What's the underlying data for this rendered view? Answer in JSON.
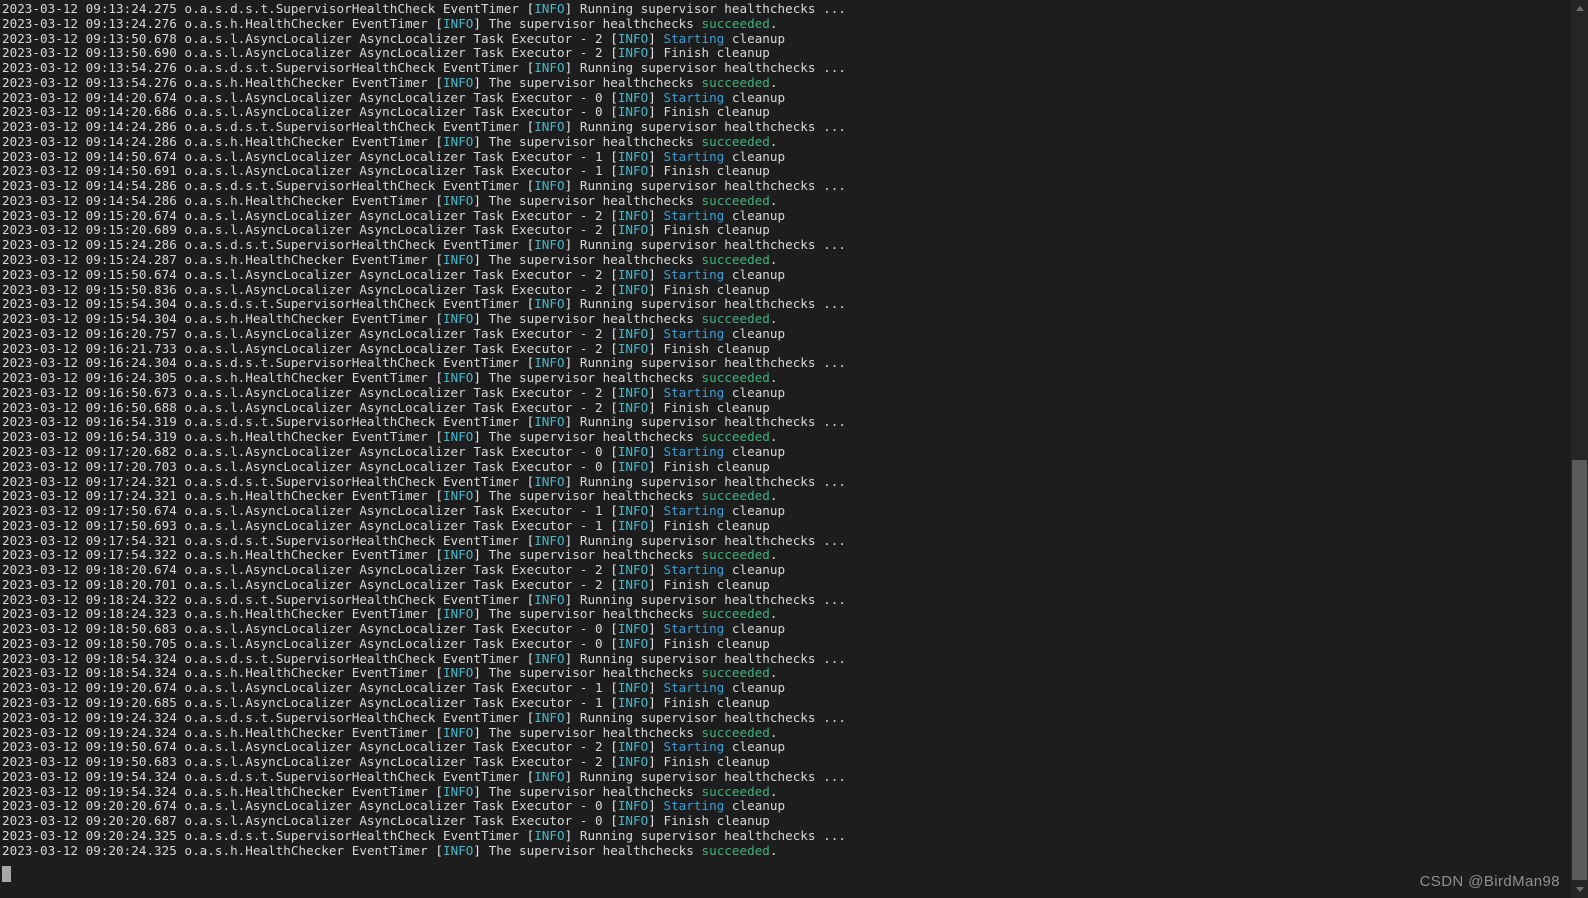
{
  "terminal": {
    "background_color": "#1d1d1d",
    "default_text_color": "#d8d8d8",
    "level_color": "#49b8c9",
    "success_color": "#3fb27f",
    "starting_color": "#3a9fd8",
    "cursor": {
      "name": "block-cursor",
      "color": "#a8a8a8"
    }
  },
  "scrollbar": {
    "up_arrow": "▲",
    "down_arrow": "▼",
    "thumb_color": "#5a5a5a",
    "track_color": "#252525"
  },
  "watermark": {
    "text": "CSDN @BirdMan98"
  },
  "log": {
    "lines": [
      {
        "ts": "2023-03-12 09:13:24.275",
        "logger": "o.a.s.d.s.t.SupervisorHealthCheck",
        "thread": "EventTimer",
        "level": "INFO",
        "msg_pre": "Running supervisor healthchecks ...",
        "hl": "",
        "msg_post": ""
      },
      {
        "ts": "2023-03-12 09:13:24.276",
        "logger": "o.a.s.h.HealthChecker",
        "thread": "EventTimer",
        "level": "INFO",
        "msg_pre": "The supervisor healthchecks ",
        "hl": "succeeded",
        "hl_kind": "ok",
        "msg_post": "."
      },
      {
        "ts": "2023-03-12 09:13:50.678",
        "logger": "o.a.s.l.AsyncLocalizer",
        "thread": "AsyncLocalizer Task Executor - 2",
        "level": "INFO",
        "msg_pre": "",
        "hl": "Starting",
        "hl_kind": "start",
        "msg_post": " cleanup"
      },
      {
        "ts": "2023-03-12 09:13:50.690",
        "logger": "o.a.s.l.AsyncLocalizer",
        "thread": "AsyncLocalizer Task Executor - 2",
        "level": "INFO",
        "msg_pre": "Finish cleanup",
        "hl": "",
        "msg_post": ""
      },
      {
        "ts": "2023-03-12 09:13:54.276",
        "logger": "o.a.s.d.s.t.SupervisorHealthCheck",
        "thread": "EventTimer",
        "level": "INFO",
        "msg_pre": "Running supervisor healthchecks ...",
        "hl": "",
        "msg_post": ""
      },
      {
        "ts": "2023-03-12 09:13:54.276",
        "logger": "o.a.s.h.HealthChecker",
        "thread": "EventTimer",
        "level": "INFO",
        "msg_pre": "The supervisor healthchecks ",
        "hl": "succeeded",
        "hl_kind": "ok",
        "msg_post": "."
      },
      {
        "ts": "2023-03-12 09:14:20.674",
        "logger": "o.a.s.l.AsyncLocalizer",
        "thread": "AsyncLocalizer Task Executor - 0",
        "level": "INFO",
        "msg_pre": "",
        "hl": "Starting",
        "hl_kind": "start",
        "msg_post": " cleanup"
      },
      {
        "ts": "2023-03-12 09:14:20.686",
        "logger": "o.a.s.l.AsyncLocalizer",
        "thread": "AsyncLocalizer Task Executor - 0",
        "level": "INFO",
        "msg_pre": "Finish cleanup",
        "hl": "",
        "msg_post": ""
      },
      {
        "ts": "2023-03-12 09:14:24.286",
        "logger": "o.a.s.d.s.t.SupervisorHealthCheck",
        "thread": "EventTimer",
        "level": "INFO",
        "msg_pre": "Running supervisor healthchecks ...",
        "hl": "",
        "msg_post": ""
      },
      {
        "ts": "2023-03-12 09:14:24.286",
        "logger": "o.a.s.h.HealthChecker",
        "thread": "EventTimer",
        "level": "INFO",
        "msg_pre": "The supervisor healthchecks ",
        "hl": "succeeded",
        "hl_kind": "ok",
        "msg_post": "."
      },
      {
        "ts": "2023-03-12 09:14:50.674",
        "logger": "o.a.s.l.AsyncLocalizer",
        "thread": "AsyncLocalizer Task Executor - 1",
        "level": "INFO",
        "msg_pre": "",
        "hl": "Starting",
        "hl_kind": "start",
        "msg_post": " cleanup"
      },
      {
        "ts": "2023-03-12 09:14:50.691",
        "logger": "o.a.s.l.AsyncLocalizer",
        "thread": "AsyncLocalizer Task Executor - 1",
        "level": "INFO",
        "msg_pre": "Finish cleanup",
        "hl": "",
        "msg_post": ""
      },
      {
        "ts": "2023-03-12 09:14:54.286",
        "logger": "o.a.s.d.s.t.SupervisorHealthCheck",
        "thread": "EventTimer",
        "level": "INFO",
        "msg_pre": "Running supervisor healthchecks ...",
        "hl": "",
        "msg_post": ""
      },
      {
        "ts": "2023-03-12 09:14:54.286",
        "logger": "o.a.s.h.HealthChecker",
        "thread": "EventTimer",
        "level": "INFO",
        "msg_pre": "The supervisor healthchecks ",
        "hl": "succeeded",
        "hl_kind": "ok",
        "msg_post": "."
      },
      {
        "ts": "2023-03-12 09:15:20.674",
        "logger": "o.a.s.l.AsyncLocalizer",
        "thread": "AsyncLocalizer Task Executor - 2",
        "level": "INFO",
        "msg_pre": "",
        "hl": "Starting",
        "hl_kind": "start",
        "msg_post": " cleanup"
      },
      {
        "ts": "2023-03-12 09:15:20.689",
        "logger": "o.a.s.l.AsyncLocalizer",
        "thread": "AsyncLocalizer Task Executor - 2",
        "level": "INFO",
        "msg_pre": "Finish cleanup",
        "hl": "",
        "msg_post": ""
      },
      {
        "ts": "2023-03-12 09:15:24.286",
        "logger": "o.a.s.d.s.t.SupervisorHealthCheck",
        "thread": "EventTimer",
        "level": "INFO",
        "msg_pre": "Running supervisor healthchecks ...",
        "hl": "",
        "msg_post": ""
      },
      {
        "ts": "2023-03-12 09:15:24.287",
        "logger": "o.a.s.h.HealthChecker",
        "thread": "EventTimer",
        "level": "INFO",
        "msg_pre": "The supervisor healthchecks ",
        "hl": "succeeded",
        "hl_kind": "ok",
        "msg_post": "."
      },
      {
        "ts": "2023-03-12 09:15:50.674",
        "logger": "o.a.s.l.AsyncLocalizer",
        "thread": "AsyncLocalizer Task Executor - 2",
        "level": "INFO",
        "msg_pre": "",
        "hl": "Starting",
        "hl_kind": "start",
        "msg_post": " cleanup"
      },
      {
        "ts": "2023-03-12 09:15:50.836",
        "logger": "o.a.s.l.AsyncLocalizer",
        "thread": "AsyncLocalizer Task Executor - 2",
        "level": "INFO",
        "msg_pre": "Finish cleanup",
        "hl": "",
        "msg_post": ""
      },
      {
        "ts": "2023-03-12 09:15:54.304",
        "logger": "o.a.s.d.s.t.SupervisorHealthCheck",
        "thread": "EventTimer",
        "level": "INFO",
        "msg_pre": "Running supervisor healthchecks ...",
        "hl": "",
        "msg_post": ""
      },
      {
        "ts": "2023-03-12 09:15:54.304",
        "logger": "o.a.s.h.HealthChecker",
        "thread": "EventTimer",
        "level": "INFO",
        "msg_pre": "The supervisor healthchecks ",
        "hl": "succeeded",
        "hl_kind": "ok",
        "msg_post": "."
      },
      {
        "ts": "2023-03-12 09:16:20.757",
        "logger": "o.a.s.l.AsyncLocalizer",
        "thread": "AsyncLocalizer Task Executor - 2",
        "level": "INFO",
        "msg_pre": "",
        "hl": "Starting",
        "hl_kind": "start",
        "msg_post": " cleanup"
      },
      {
        "ts": "2023-03-12 09:16:21.733",
        "logger": "o.a.s.l.AsyncLocalizer",
        "thread": "AsyncLocalizer Task Executor - 2",
        "level": "INFO",
        "msg_pre": "Finish cleanup",
        "hl": "",
        "msg_post": ""
      },
      {
        "ts": "2023-03-12 09:16:24.304",
        "logger": "o.a.s.d.s.t.SupervisorHealthCheck",
        "thread": "EventTimer",
        "level": "INFO",
        "msg_pre": "Running supervisor healthchecks ...",
        "hl": "",
        "msg_post": ""
      },
      {
        "ts": "2023-03-12 09:16:24.305",
        "logger": "o.a.s.h.HealthChecker",
        "thread": "EventTimer",
        "level": "INFO",
        "msg_pre": "The supervisor healthchecks ",
        "hl": "succeeded",
        "hl_kind": "ok",
        "msg_post": "."
      },
      {
        "ts": "2023-03-12 09:16:50.673",
        "logger": "o.a.s.l.AsyncLocalizer",
        "thread": "AsyncLocalizer Task Executor - 2",
        "level": "INFO",
        "msg_pre": "",
        "hl": "Starting",
        "hl_kind": "start",
        "msg_post": " cleanup"
      },
      {
        "ts": "2023-03-12 09:16:50.688",
        "logger": "o.a.s.l.AsyncLocalizer",
        "thread": "AsyncLocalizer Task Executor - 2",
        "level": "INFO",
        "msg_pre": "Finish cleanup",
        "hl": "",
        "msg_post": ""
      },
      {
        "ts": "2023-03-12 09:16:54.319",
        "logger": "o.a.s.d.s.t.SupervisorHealthCheck",
        "thread": "EventTimer",
        "level": "INFO",
        "msg_pre": "Running supervisor healthchecks ...",
        "hl": "",
        "msg_post": ""
      },
      {
        "ts": "2023-03-12 09:16:54.319",
        "logger": "o.a.s.h.HealthChecker",
        "thread": "EventTimer",
        "level": "INFO",
        "msg_pre": "The supervisor healthchecks ",
        "hl": "succeeded",
        "hl_kind": "ok",
        "msg_post": "."
      },
      {
        "ts": "2023-03-12 09:17:20.682",
        "logger": "o.a.s.l.AsyncLocalizer",
        "thread": "AsyncLocalizer Task Executor - 0",
        "level": "INFO",
        "msg_pre": "",
        "hl": "Starting",
        "hl_kind": "start",
        "msg_post": " cleanup"
      },
      {
        "ts": "2023-03-12 09:17:20.703",
        "logger": "o.a.s.l.AsyncLocalizer",
        "thread": "AsyncLocalizer Task Executor - 0",
        "level": "INFO",
        "msg_pre": "Finish cleanup",
        "hl": "",
        "msg_post": ""
      },
      {
        "ts": "2023-03-12 09:17:24.321",
        "logger": "o.a.s.d.s.t.SupervisorHealthCheck",
        "thread": "EventTimer",
        "level": "INFO",
        "msg_pre": "Running supervisor healthchecks ...",
        "hl": "",
        "msg_post": ""
      },
      {
        "ts": "2023-03-12 09:17:24.321",
        "logger": "o.a.s.h.HealthChecker",
        "thread": "EventTimer",
        "level": "INFO",
        "msg_pre": "The supervisor healthchecks ",
        "hl": "succeeded",
        "hl_kind": "ok",
        "msg_post": "."
      },
      {
        "ts": "2023-03-12 09:17:50.674",
        "logger": "o.a.s.l.AsyncLocalizer",
        "thread": "AsyncLocalizer Task Executor - 1",
        "level": "INFO",
        "msg_pre": "",
        "hl": "Starting",
        "hl_kind": "start",
        "msg_post": " cleanup"
      },
      {
        "ts": "2023-03-12 09:17:50.693",
        "logger": "o.a.s.l.AsyncLocalizer",
        "thread": "AsyncLocalizer Task Executor - 1",
        "level": "INFO",
        "msg_pre": "Finish cleanup",
        "hl": "",
        "msg_post": ""
      },
      {
        "ts": "2023-03-12 09:17:54.321",
        "logger": "o.a.s.d.s.t.SupervisorHealthCheck",
        "thread": "EventTimer",
        "level": "INFO",
        "msg_pre": "Running supervisor healthchecks ...",
        "hl": "",
        "msg_post": ""
      },
      {
        "ts": "2023-03-12 09:17:54.322",
        "logger": "o.a.s.h.HealthChecker",
        "thread": "EventTimer",
        "level": "INFO",
        "msg_pre": "The supervisor healthchecks ",
        "hl": "succeeded",
        "hl_kind": "ok",
        "msg_post": "."
      },
      {
        "ts": "2023-03-12 09:18:20.674",
        "logger": "o.a.s.l.AsyncLocalizer",
        "thread": "AsyncLocalizer Task Executor - 2",
        "level": "INFO",
        "msg_pre": "",
        "hl": "Starting",
        "hl_kind": "start",
        "msg_post": " cleanup"
      },
      {
        "ts": "2023-03-12 09:18:20.701",
        "logger": "o.a.s.l.AsyncLocalizer",
        "thread": "AsyncLocalizer Task Executor - 2",
        "level": "INFO",
        "msg_pre": "Finish cleanup",
        "hl": "",
        "msg_post": ""
      },
      {
        "ts": "2023-03-12 09:18:24.322",
        "logger": "o.a.s.d.s.t.SupervisorHealthCheck",
        "thread": "EventTimer",
        "level": "INFO",
        "msg_pre": "Running supervisor healthchecks ...",
        "hl": "",
        "msg_post": ""
      },
      {
        "ts": "2023-03-12 09:18:24.323",
        "logger": "o.a.s.h.HealthChecker",
        "thread": "EventTimer",
        "level": "INFO",
        "msg_pre": "The supervisor healthchecks ",
        "hl": "succeeded",
        "hl_kind": "ok",
        "msg_post": "."
      },
      {
        "ts": "2023-03-12 09:18:50.683",
        "logger": "o.a.s.l.AsyncLocalizer",
        "thread": "AsyncLocalizer Task Executor - 0",
        "level": "INFO",
        "msg_pre": "",
        "hl": "Starting",
        "hl_kind": "start",
        "msg_post": " cleanup"
      },
      {
        "ts": "2023-03-12 09:18:50.705",
        "logger": "o.a.s.l.AsyncLocalizer",
        "thread": "AsyncLocalizer Task Executor - 0",
        "level": "INFO",
        "msg_pre": "Finish cleanup",
        "hl": "",
        "msg_post": ""
      },
      {
        "ts": "2023-03-12 09:18:54.324",
        "logger": "o.a.s.d.s.t.SupervisorHealthCheck",
        "thread": "EventTimer",
        "level": "INFO",
        "msg_pre": "Running supervisor healthchecks ...",
        "hl": "",
        "msg_post": ""
      },
      {
        "ts": "2023-03-12 09:18:54.324",
        "logger": "o.a.s.h.HealthChecker",
        "thread": "EventTimer",
        "level": "INFO",
        "msg_pre": "The supervisor healthchecks ",
        "hl": "succeeded",
        "hl_kind": "ok",
        "msg_post": "."
      },
      {
        "ts": "2023-03-12 09:19:20.674",
        "logger": "o.a.s.l.AsyncLocalizer",
        "thread": "AsyncLocalizer Task Executor - 1",
        "level": "INFO",
        "msg_pre": "",
        "hl": "Starting",
        "hl_kind": "start",
        "msg_post": " cleanup"
      },
      {
        "ts": "2023-03-12 09:19:20.685",
        "logger": "o.a.s.l.AsyncLocalizer",
        "thread": "AsyncLocalizer Task Executor - 1",
        "level": "INFO",
        "msg_pre": "Finish cleanup",
        "hl": "",
        "msg_post": ""
      },
      {
        "ts": "2023-03-12 09:19:24.324",
        "logger": "o.a.s.d.s.t.SupervisorHealthCheck",
        "thread": "EventTimer",
        "level": "INFO",
        "msg_pre": "Running supervisor healthchecks ...",
        "hl": "",
        "msg_post": ""
      },
      {
        "ts": "2023-03-12 09:19:24.324",
        "logger": "o.a.s.h.HealthChecker",
        "thread": "EventTimer",
        "level": "INFO",
        "msg_pre": "The supervisor healthchecks ",
        "hl": "succeeded",
        "hl_kind": "ok",
        "msg_post": "."
      },
      {
        "ts": "2023-03-12 09:19:50.674",
        "logger": "o.a.s.l.AsyncLocalizer",
        "thread": "AsyncLocalizer Task Executor - 2",
        "level": "INFO",
        "msg_pre": "",
        "hl": "Starting",
        "hl_kind": "start",
        "msg_post": " cleanup"
      },
      {
        "ts": "2023-03-12 09:19:50.683",
        "logger": "o.a.s.l.AsyncLocalizer",
        "thread": "AsyncLocalizer Task Executor - 2",
        "level": "INFO",
        "msg_pre": "Finish cleanup",
        "hl": "",
        "msg_post": ""
      },
      {
        "ts": "2023-03-12 09:19:54.324",
        "logger": "o.a.s.d.s.t.SupervisorHealthCheck",
        "thread": "EventTimer",
        "level": "INFO",
        "msg_pre": "Running supervisor healthchecks ...",
        "hl": "",
        "msg_post": ""
      },
      {
        "ts": "2023-03-12 09:19:54.324",
        "logger": "o.a.s.h.HealthChecker",
        "thread": "EventTimer",
        "level": "INFO",
        "msg_pre": "The supervisor healthchecks ",
        "hl": "succeeded",
        "hl_kind": "ok",
        "msg_post": "."
      },
      {
        "ts": "2023-03-12 09:20:20.674",
        "logger": "o.a.s.l.AsyncLocalizer",
        "thread": "AsyncLocalizer Task Executor - 0",
        "level": "INFO",
        "msg_pre": "",
        "hl": "Starting",
        "hl_kind": "start",
        "msg_post": " cleanup"
      },
      {
        "ts": "2023-03-12 09:20:20.687",
        "logger": "o.a.s.l.AsyncLocalizer",
        "thread": "AsyncLocalizer Task Executor - 0",
        "level": "INFO",
        "msg_pre": "Finish cleanup",
        "hl": "",
        "msg_post": ""
      },
      {
        "ts": "2023-03-12 09:20:24.325",
        "logger": "o.a.s.d.s.t.SupervisorHealthCheck",
        "thread": "EventTimer",
        "level": "INFO",
        "msg_pre": "Running supervisor healthchecks ...",
        "hl": "",
        "msg_post": ""
      },
      {
        "ts": "2023-03-12 09:20:24.325",
        "logger": "o.a.s.h.HealthChecker",
        "thread": "EventTimer",
        "level": "INFO",
        "msg_pre": "The supervisor healthchecks ",
        "hl": "succeeded",
        "hl_kind": "ok",
        "msg_post": "."
      }
    ]
  }
}
